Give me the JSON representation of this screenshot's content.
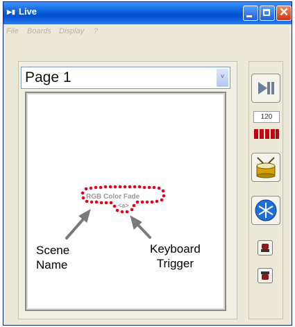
{
  "window": {
    "title": "Live"
  },
  "menu": {
    "items": [
      "File",
      "Boards",
      "Display",
      "?"
    ]
  },
  "page_select": {
    "value": "Page  1"
  },
  "scene": {
    "name": "RGB Color Fade",
    "key": "<a>"
  },
  "annotations": {
    "scene_name": [
      "Scene",
      "Name"
    ],
    "keyboard_trigger": [
      "Keyboard",
      "Trigger"
    ]
  },
  "toolbar": {
    "bpm": "120"
  },
  "colors": {
    "annotation_dots": "#e8001c",
    "beat_meter": "#c40010",
    "title_bar": "#0a5fd8"
  }
}
